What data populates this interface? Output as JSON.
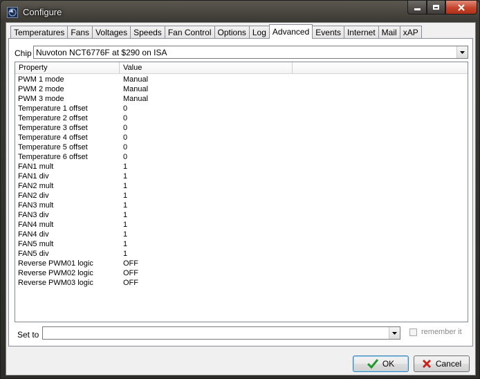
{
  "window": {
    "title": "Configure"
  },
  "tabs": [
    {
      "label": "Temperatures",
      "active": false
    },
    {
      "label": "Fans",
      "active": false
    },
    {
      "label": "Voltages",
      "active": false
    },
    {
      "label": "Speeds",
      "active": false
    },
    {
      "label": "Fan Control",
      "active": false
    },
    {
      "label": "Options",
      "active": false
    },
    {
      "label": "Log",
      "active": false
    },
    {
      "label": "Advanced",
      "active": true
    },
    {
      "label": "Events",
      "active": false
    },
    {
      "label": "Internet",
      "active": false
    },
    {
      "label": "Mail",
      "active": false
    },
    {
      "label": "xAP",
      "active": false
    }
  ],
  "chip": {
    "label": "Chip",
    "value": "Nuvoton NCT6776F at $290 on ISA"
  },
  "table": {
    "columns": [
      "Property",
      "Value"
    ],
    "rows": [
      [
        "PWM 1 mode",
        "Manual"
      ],
      [
        "PWM 2 mode",
        "Manual"
      ],
      [
        "PWM 3 mode",
        "Manual"
      ],
      [
        "Temperature 1 offset",
        "0"
      ],
      [
        "Temperature 2 offset",
        "0"
      ],
      [
        "Temperature 3 offset",
        "0"
      ],
      [
        "Temperature 4 offset",
        "0"
      ],
      [
        "Temperature 5 offset",
        "0"
      ],
      [
        "Temperature 6 offset",
        "0"
      ],
      [
        "FAN1 mult",
        "1"
      ],
      [
        "FAN1 div",
        "1"
      ],
      [
        "FAN2 mult",
        "1"
      ],
      [
        "FAN2 div",
        "1"
      ],
      [
        "FAN3 mult",
        "1"
      ],
      [
        "FAN3 div",
        "1"
      ],
      [
        "FAN4 mult",
        "1"
      ],
      [
        "FAN4 div",
        "1"
      ],
      [
        "FAN5 mult",
        "1"
      ],
      [
        "FAN5 div",
        "1"
      ],
      [
        "Reverse PWM01 logic",
        "OFF"
      ],
      [
        "Reverse PWM02 logic",
        "OFF"
      ],
      [
        "Reverse PWM03 logic",
        "OFF"
      ]
    ]
  },
  "set_to": {
    "label": "Set to",
    "value": ""
  },
  "remember": {
    "label": "remember it",
    "checked": false,
    "enabled": false
  },
  "buttons": {
    "ok": "OK",
    "cancel": "Cancel"
  },
  "icons": {
    "ok": "check-icon",
    "cancel": "x-icon",
    "minimize": "minimize-icon",
    "maximize": "maximize-icon",
    "close": "close-icon"
  },
  "colors": {
    "ok_check": "#1e9a2a",
    "cancel_x": "#c8201a",
    "close_button": "#c5452c"
  }
}
